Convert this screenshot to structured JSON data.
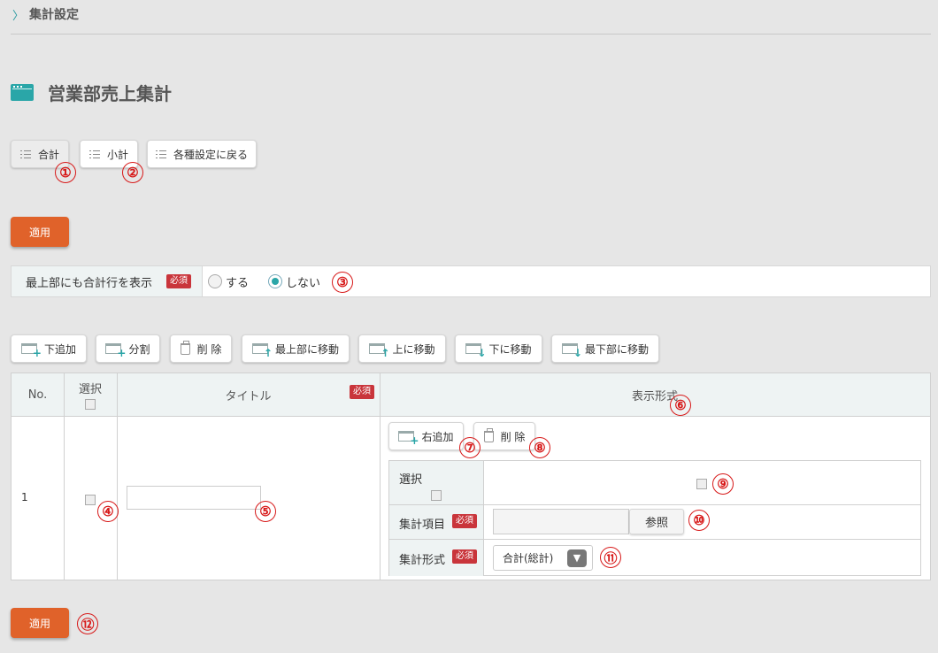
{
  "breadcrumb": {
    "label": "集計設定"
  },
  "page": {
    "title": "営業部売上集計"
  },
  "tabs": [
    {
      "label": "合計"
    },
    {
      "label": "小計"
    },
    {
      "label": "各種設定に戻る"
    }
  ],
  "apply_label": "適用",
  "setting": {
    "label": "最上部にも合計行を表示",
    "required": "必須",
    "options": [
      {
        "label": "する",
        "selected": false
      },
      {
        "label": "しない",
        "selected": true
      }
    ]
  },
  "toolbar": [
    {
      "label": "下追加"
    },
    {
      "label": "分割"
    },
    {
      "label": "削 除"
    },
    {
      "label": "最上部に移動"
    },
    {
      "label": "上に移動"
    },
    {
      "label": "下に移動"
    },
    {
      "label": "最下部に移動"
    }
  ],
  "table": {
    "headers": {
      "no": "No.",
      "select": "選択",
      "title": "タイトル",
      "required": "必須",
      "format": "表示形式"
    },
    "rows": [
      {
        "no": "1",
        "title_value": ""
      }
    ]
  },
  "format": {
    "add_right": "右追加",
    "delete": "削 除",
    "select_label": "選択",
    "item_label": "集計項目",
    "item_required": "必須",
    "item_value": "",
    "browse_label": "参照",
    "type_label": "集計形式",
    "type_required": "必須",
    "type_value": "合計(総計)"
  },
  "annotations": [
    "①",
    "②",
    "③",
    "④",
    "⑤",
    "⑥",
    "⑦",
    "⑧",
    "⑨",
    "⑩",
    "⑪",
    "⑫"
  ],
  "colors": {
    "accent": "#2aa6a8",
    "apply": "#e0622a",
    "required": "#c9353b",
    "annotation": "#d71818"
  }
}
